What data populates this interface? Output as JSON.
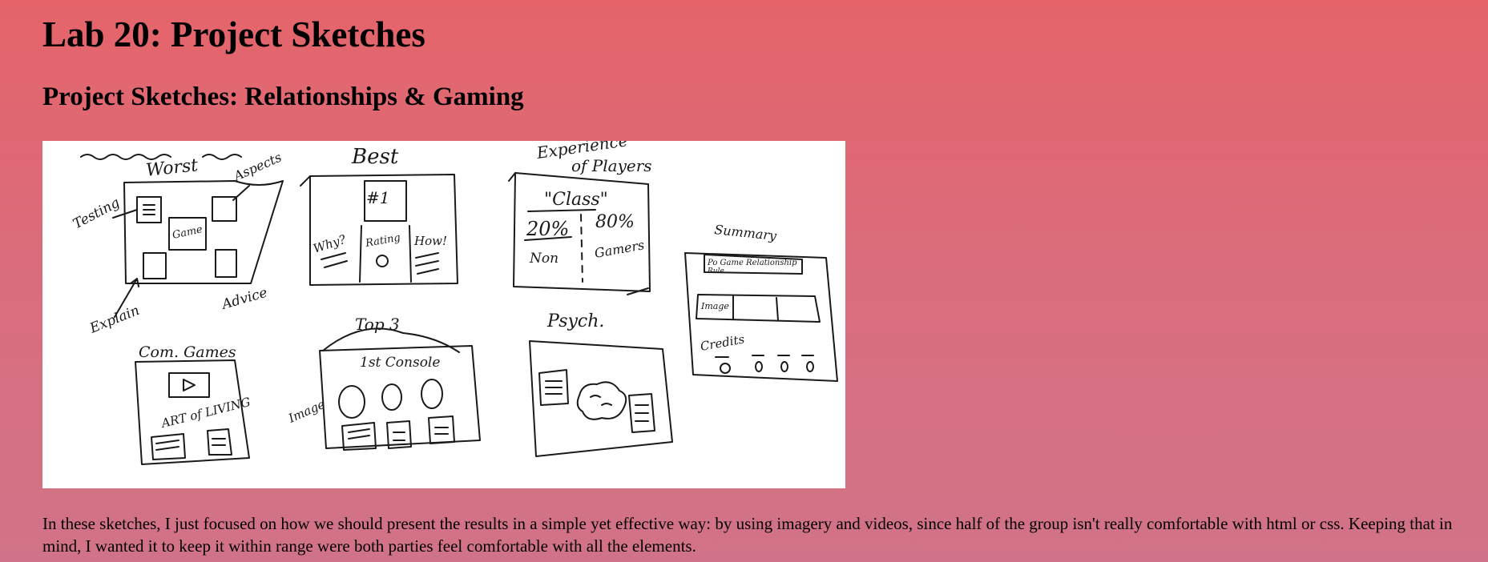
{
  "page": {
    "title": "Lab 20: Project Sketches",
    "subtitle": "Project Sketches: Relationships & Gaming",
    "description": "In these sketches, I just focused on how we should present the results in a simple yet effective way: by using imagery and videos, since half of the group isn't really comfortable with html or css. Keeping that in mind, I wanted it to keep it within range were both parties feel comfortable with all the elements."
  },
  "sketch": {
    "labels": {
      "worst": "Worst",
      "testing": "Testing",
      "aspects": "Aspects",
      "game": "Game",
      "explain": "Explain",
      "advice": "Advice",
      "best": "Best",
      "number_one": "#1",
      "why": "Why?",
      "rating": "Rating",
      "how": "How!",
      "experience": "Experience",
      "of_players": "of Players",
      "class": "\"Class\"",
      "pct_20": "20%",
      "pct_80": "80%",
      "non": "Non",
      "gamers": "Gamers",
      "summary": "Summary",
      "summary_cols": "Po  Game  Relationship",
      "summary_rule": "Rule",
      "summary_image": "Image",
      "credits": "Credits",
      "com_games": "Com. Games",
      "art_of_living": "ART of LIVING",
      "top_3": "Top 3",
      "first_console": "1st Console",
      "image": "Image",
      "psych": "Psych."
    }
  }
}
